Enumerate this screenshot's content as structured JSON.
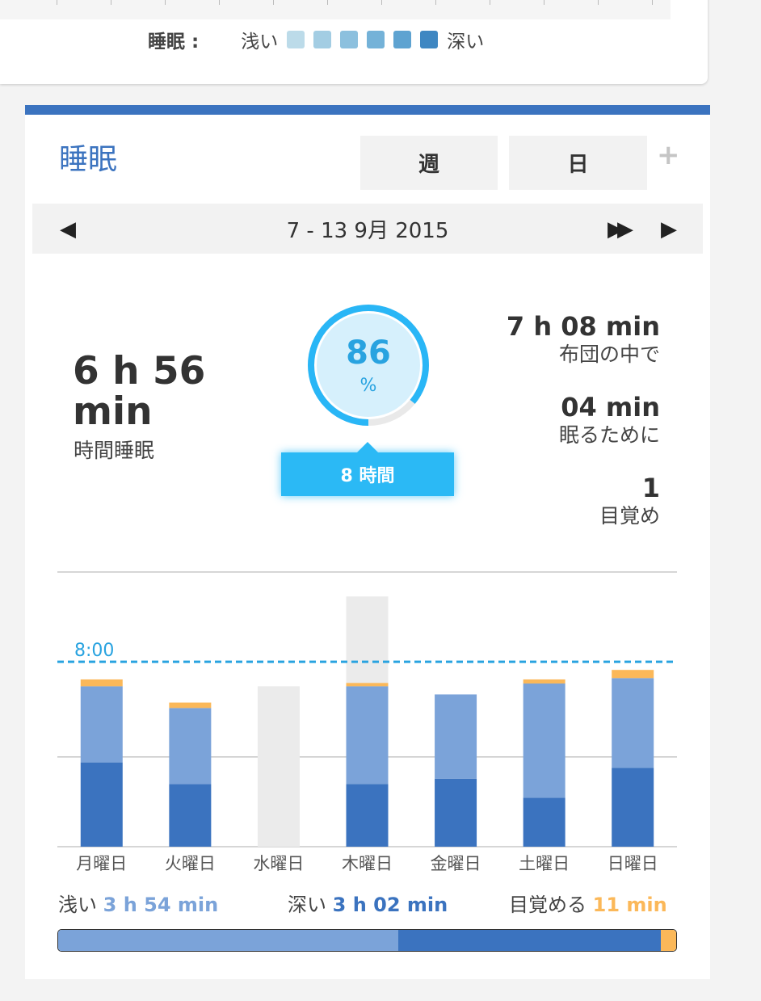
{
  "legend": {
    "title": "睡眠 :",
    "low": "浅い",
    "high": "深い",
    "swatches": [
      "#bcdbe9",
      "#a3cde3",
      "#8cc0de",
      "#74b2d8",
      "#5ea3d1",
      "#3f87c2"
    ]
  },
  "card": {
    "title": "睡眠",
    "tabs": [
      "週",
      "日"
    ],
    "add_icon": "+",
    "nav": {
      "prev_icon": "◀",
      "range": "7 - 13 9月 2015",
      "fast_forward_icon": "▶▶",
      "next_icon": "▶"
    }
  },
  "summary": {
    "total_sleep": "6 h 56 min",
    "total_label": "時間睡眠",
    "efficiency": "86",
    "efficiency_unit": "%",
    "efficiency_fraction": 0.86,
    "goal": "8 時間",
    "stats": [
      {
        "value": "7 h 08 min",
        "label": "布団の中で"
      },
      {
        "value": "04 min",
        "label": "眠るために"
      },
      {
        "value": "1",
        "label": "目覚め"
      }
    ]
  },
  "chart_data": {
    "type": "bar",
    "stacked": true,
    "categories": [
      "月曜日",
      "火曜日",
      "水曜日",
      "木曜日",
      "金曜日",
      "土曜日",
      "日曜日"
    ],
    "series": [
      {
        "name": "深い",
        "color": "#3b73bf",
        "values": [
          3.1,
          2.3,
          0,
          2.3,
          2.5,
          1.8,
          2.9
        ]
      },
      {
        "name": "浅い",
        "color": "#7ba3d9",
        "values": [
          2.8,
          2.8,
          0,
          3.6,
          3.1,
          4.2,
          3.3
        ]
      },
      {
        "name": "目覚める",
        "color": "#fbb859",
        "values": [
          0.25,
          0.2,
          0,
          0.12,
          0,
          0.15,
          0.3
        ]
      }
    ],
    "in_bed_gray": [
      0,
      0,
      5.9,
      9.2,
      0,
      0,
      0
    ],
    "goal_line": {
      "value": 6.8,
      "label": "8:00",
      "color": "#29a3e0"
    },
    "ylim": [
      0,
      10.1
    ],
    "gridlines": [
      3.3,
      10.1
    ]
  },
  "totals": {
    "light_label": "浅い",
    "light_value": "3 h 54 min",
    "deep_label": "深い",
    "deep_value": "3 h 02 min",
    "awake_label": "目覚める",
    "awake_value": "11 min",
    "proportions": {
      "light": 0.55,
      "deep": 0.425,
      "awake": 0.025
    }
  }
}
